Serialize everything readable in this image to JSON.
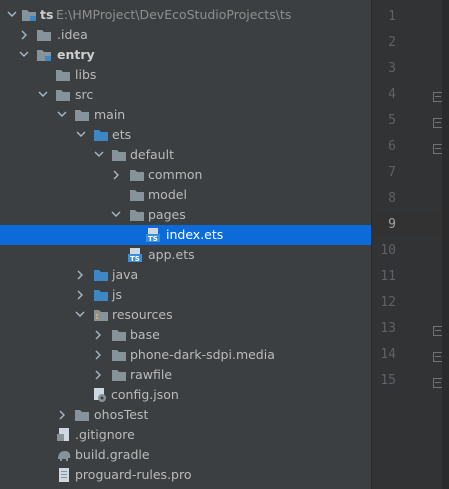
{
  "project": {
    "root_name": "ts",
    "root_path": "E:\\HMProject\\DevEcoStudioProjects\\ts"
  },
  "tree": [
    {
      "id": "root",
      "label": "ts",
      "expanded": true
    },
    {
      "id": "idea",
      "label": ".idea",
      "expanded": false
    },
    {
      "id": "entry",
      "label": "entry",
      "expanded": true
    },
    {
      "id": "libs",
      "label": "libs"
    },
    {
      "id": "src",
      "label": "src",
      "expanded": true
    },
    {
      "id": "main",
      "label": "main",
      "expanded": true
    },
    {
      "id": "ets",
      "label": "ets",
      "expanded": true
    },
    {
      "id": "default",
      "label": "default",
      "expanded": true
    },
    {
      "id": "common",
      "label": "common",
      "expanded": false
    },
    {
      "id": "model",
      "label": "model"
    },
    {
      "id": "pages",
      "label": "pages",
      "expanded": true
    },
    {
      "id": "index",
      "label": "index.ets",
      "selected": true
    },
    {
      "id": "app",
      "label": "app.ets"
    },
    {
      "id": "java",
      "label": "java",
      "expanded": false
    },
    {
      "id": "js",
      "label": "js",
      "expanded": false
    },
    {
      "id": "resources",
      "label": "resources",
      "expanded": true
    },
    {
      "id": "base",
      "label": "base",
      "expanded": false
    },
    {
      "id": "phone",
      "label": "phone-dark-sdpi.media",
      "expanded": false
    },
    {
      "id": "rawfile",
      "label": "rawfile",
      "expanded": false
    },
    {
      "id": "config",
      "label": "config.json"
    },
    {
      "id": "ohostest",
      "label": "ohosTest",
      "expanded": false
    },
    {
      "id": "gitignore",
      "label": ".gitignore"
    },
    {
      "id": "buildgradle",
      "label": "build.gradle"
    },
    {
      "id": "proguard",
      "label": "proguard-rules.pro"
    }
  ],
  "editor": {
    "line_numbers": [
      "1",
      "2",
      "3",
      "4",
      "5",
      "6",
      "7",
      "8",
      "9",
      "10",
      "11",
      "12",
      "13",
      "14",
      "15"
    ],
    "current_line": "9"
  },
  "colors": {
    "panel_bg": "#3c3f41",
    "selection": "#0d6bd9",
    "folder": "#87939a",
    "folder_blue": "#3d88c4",
    "ts_badge": "#3a8fd9",
    "gutter_bg": "#313335"
  }
}
